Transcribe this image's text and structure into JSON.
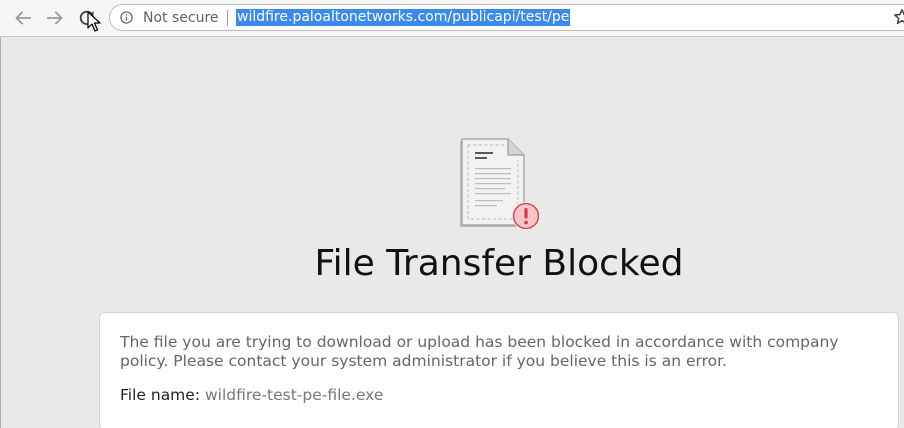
{
  "browser": {
    "security_label": "Not secure",
    "url": "wildfire.paloaltonetworks.com/publicapi/test/pe"
  },
  "page": {
    "title": "File Transfer Blocked",
    "message": "The file you are trying to download or upload has been blocked in accordance with company policy. Please contact your system administrator if you believe this is an error.",
    "file_name_label": "File name:",
    "file_name_value": "wildfire-test-pe-file.exe"
  },
  "icons": {
    "back": "arrow-left-icon",
    "forward": "arrow-right-icon",
    "reload": "reload-icon",
    "info": "info-icon",
    "star": "star-icon",
    "document": "document-icon",
    "alert": "exclamation-alert-icon"
  },
  "colors": {
    "url_highlight": "#3a8af0",
    "alert_red": "#e0555b",
    "page_background": "#e9e9e9"
  }
}
